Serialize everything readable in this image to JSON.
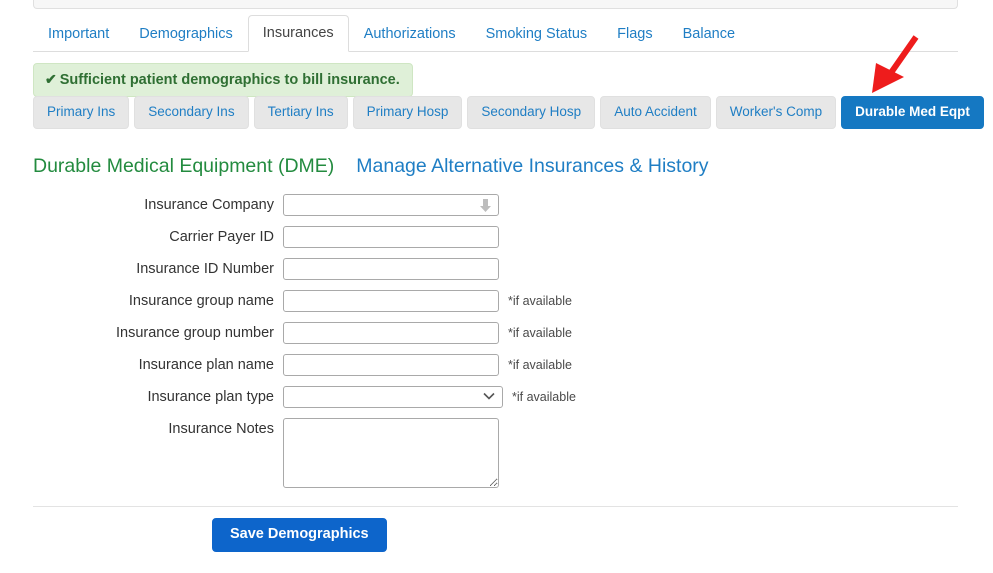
{
  "tabs": [
    {
      "label": "Important",
      "active": false
    },
    {
      "label": "Demographics",
      "active": false
    },
    {
      "label": "Insurances",
      "active": true
    },
    {
      "label": "Authorizations",
      "active": false
    },
    {
      "label": "Smoking Status",
      "active": false
    },
    {
      "label": "Flags",
      "active": false
    },
    {
      "label": "Balance",
      "active": false
    }
  ],
  "alert": {
    "icon": "check-icon",
    "check_glyph": "✔",
    "message": "Sufficient patient demographics to bill insurance.",
    "background_color": "#dff0d8",
    "text_color": "#2f6f33"
  },
  "subtabs": [
    {
      "label": "Primary Ins",
      "active": false
    },
    {
      "label": "Secondary Ins",
      "active": false
    },
    {
      "label": "Tertiary Ins",
      "active": false
    },
    {
      "label": "Primary Hosp",
      "active": false
    },
    {
      "label": "Secondary Hosp",
      "active": false
    },
    {
      "label": "Auto Accident",
      "active": false
    },
    {
      "label": "Worker's Comp",
      "active": false
    },
    {
      "label": "Durable Med Eqpt",
      "active": true
    }
  ],
  "annotation": {
    "type": "red-arrow",
    "color": "#ee1c1c",
    "points_to": "Durable Med Eqpt"
  },
  "section": {
    "title": "Durable Medical Equipment (DME)",
    "title_color": "#238b3f",
    "link_label": "Manage Alternative Insurances & History",
    "link_color": "#1f7ec4"
  },
  "form": {
    "fields": [
      {
        "label": "Insurance Company",
        "control": "autocomplete",
        "value": "",
        "placeholder": "",
        "hint": ""
      },
      {
        "label": "Carrier Payer ID",
        "control": "text",
        "value": "",
        "placeholder": "",
        "hint": ""
      },
      {
        "label": "Insurance ID Number",
        "control": "text",
        "value": "",
        "placeholder": "",
        "hint": ""
      },
      {
        "label": "Insurance group name",
        "control": "text",
        "value": "",
        "placeholder": "",
        "hint": "*if available"
      },
      {
        "label": "Insurance group number",
        "control": "text",
        "value": "",
        "placeholder": "",
        "hint": "*if available"
      },
      {
        "label": "Insurance plan name",
        "control": "text",
        "value": "",
        "placeholder": "",
        "hint": "*if available"
      },
      {
        "label": "Insurance plan type",
        "control": "select",
        "value": "",
        "placeholder": "",
        "hint": "*if available",
        "options": [
          ""
        ]
      },
      {
        "label": "Insurance Notes",
        "control": "textarea",
        "value": "",
        "placeholder": "",
        "hint": ""
      }
    ]
  },
  "footer": {
    "save_label": "Save Demographics",
    "save_color": "#0d65cb"
  }
}
